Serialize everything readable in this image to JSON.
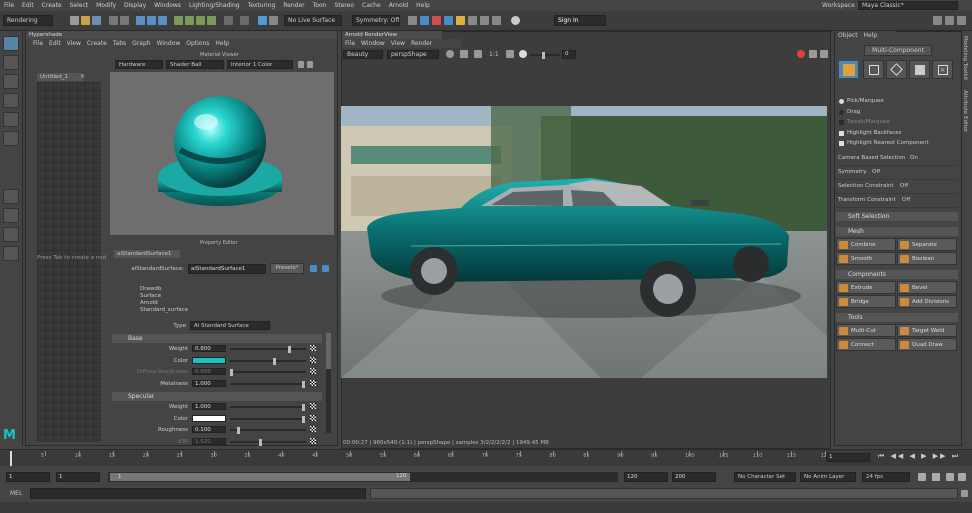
{
  "menu": [
    "File",
    "Edit",
    "Create",
    "Select",
    "Modify",
    "Display",
    "Windows",
    "Lighting/Shading",
    "Texturing",
    "Render",
    "Toon",
    "Stereo",
    "Cache",
    "Arnold",
    "Help"
  ],
  "workspace": {
    "label": "Workspace :",
    "value": "Maya Classic*"
  },
  "shelf": {
    "mode": "Rendering",
    "live_surface": "No Live Surface",
    "symmetry": "Symmetry: Off",
    "sign_in": "Sign In"
  },
  "hypershade": {
    "title": "Hypershade",
    "menu": [
      "File",
      "Edit",
      "View",
      "Create",
      "Tabs",
      "Graph",
      "Window",
      "Options",
      "Help"
    ],
    "tab": "Untitled_1",
    "hint": "Press Tab to create a nod"
  },
  "material_viewer": {
    "title": "Material Viewer",
    "renderer": "Hardware",
    "shape": "Shader Ball",
    "env": "Interior 1 Color"
  },
  "property_editor": {
    "title": "Property Editor",
    "node_tab": "aiStandardSurface1",
    "node_label": "aiStandardSurface:",
    "node_name": "aiStandardSurface1",
    "presets": "Presets*",
    "classification": [
      "Drawdb",
      "Surface",
      "Arnold",
      "Standard_surface"
    ],
    "type_label": "Type",
    "type_value": "Ai Standard Surface",
    "base_section": "Base",
    "base": [
      {
        "label": "Weight",
        "value": "0.800",
        "fill": 0.8
      },
      {
        "label": "Color",
        "value": "",
        "fill": 0.6
      },
      {
        "label": "Diffuse Roughness",
        "value": "0.000",
        "fill": 0.0
      },
      {
        "label": "Metalness",
        "value": "1.000",
        "fill": 1.0
      }
    ],
    "specular_section": "Specular",
    "specular": [
      {
        "label": "Weight",
        "value": "1.000",
        "fill": 1.0
      },
      {
        "label": "Color",
        "value": "",
        "fill": 1.0
      },
      {
        "label": "Roughness",
        "value": "0.100",
        "fill": 0.1
      },
      {
        "label": "IOR",
        "value": "1.520",
        "fill": 0.4
      }
    ],
    "base_color": "#17c4c4",
    "spec_color": "#ffffff"
  },
  "render_view": {
    "title": "Arnold RenderView",
    "menu": [
      "File",
      "Window",
      "View",
      "Render"
    ],
    "aov": "Beauty",
    "camera": "perspShape",
    "zoom": "1:1",
    "exposure": "0",
    "status": "00:00:27 | 960x540 (1:1) | perspShape | samples 3/2/2/2/2/2 | 1949.45 MB"
  },
  "modeling_toolkit": {
    "menu": [
      "Object",
      "Help"
    ],
    "mode": "Multi-Component",
    "selection": [
      {
        "label": "Pick/Marquee",
        "type": "radio",
        "on": true
      },
      {
        "label": "Drag",
        "type": "radio",
        "on": false
      },
      {
        "label": "Tweak/Marquee",
        "type": "check",
        "on": false
      },
      {
        "label": "Highlight Backfaces",
        "type": "check",
        "on": true
      },
      {
        "label": "Highlight Nearest Component",
        "type": "check",
        "on": true
      }
    ],
    "options": [
      {
        "label": "Camera Based Selection",
        "value": "On"
      },
      {
        "label": "Symmetry",
        "value": "Off"
      },
      {
        "label": "Selection Constraint",
        "value": "Off"
      },
      {
        "label": "Transform Constraint",
        "value": "Off"
      }
    ],
    "soft_selection": "Soft Selection",
    "mesh_section": "Mesh",
    "mesh": [
      "Combine",
      "Separate",
      "Smooth",
      "Boolean"
    ],
    "components_section": "Components",
    "components": [
      "Extrude",
      "Bevel",
      "Bridge",
      "Add Divisions"
    ],
    "tools_section": "Tools",
    "tools": [
      "Multi-Cut",
      "Target Weld",
      "Connect",
      "Quad Draw"
    ]
  },
  "side_tabs": [
    "Modeling Toolkit",
    "Attribute Editor"
  ],
  "timeline": {
    "ticks": [
      "5",
      "10",
      "15",
      "20",
      "25",
      "30",
      "35",
      "40",
      "45",
      "50",
      "55",
      "60",
      "65",
      "70",
      "75",
      "80",
      "85",
      "90",
      "95",
      "100",
      "105",
      "110",
      "115",
      "120"
    ],
    "current_frame": "1"
  },
  "range": {
    "start": "1",
    "start2": "1",
    "range_start": "1",
    "range_end": "120",
    "end": "120",
    "end2": "200",
    "character_set": "No Character Set",
    "anim_layer": "No Anim Layer",
    "fps": "24 fps"
  },
  "command_line": {
    "label": "MEL"
  },
  "colors": {
    "accent": "#5285a6",
    "teal": "#17c4c4",
    "orange": "#cc8a3d"
  }
}
